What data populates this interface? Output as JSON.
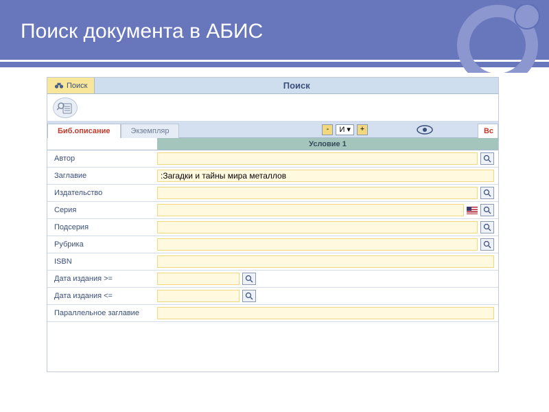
{
  "slide": {
    "title": "Поиск документа в АБИС"
  },
  "tabs": {
    "search": "Поиск",
    "page_title": "Поиск"
  },
  "subtabs": {
    "bib": "Биб.описание",
    "exemplar": "Экземпляр",
    "vo": "Вс"
  },
  "controls": {
    "minus": "-",
    "logic": "И",
    "plus": "+"
  },
  "cond": {
    "header": "Условие 1"
  },
  "fields": {
    "author": {
      "label": "Автор",
      "value": ""
    },
    "title": {
      "label": "Заглавие",
      "value": ":Загадки и тайны мира металлов"
    },
    "publisher": {
      "label": "Издательство",
      "value": ""
    },
    "series": {
      "label": "Серия",
      "value": ""
    },
    "subseries": {
      "label": "Подсерия",
      "value": ""
    },
    "rubric": {
      "label": "Рубрика",
      "value": ""
    },
    "isbn": {
      "label": "ISBN",
      "value": ""
    },
    "date_from": {
      "label": "Дата издания >=",
      "value": ""
    },
    "date_to": {
      "label": "Дата издания <=",
      "value": ""
    },
    "parallel": {
      "label": "Параллельное заглавие",
      "value": ""
    }
  }
}
